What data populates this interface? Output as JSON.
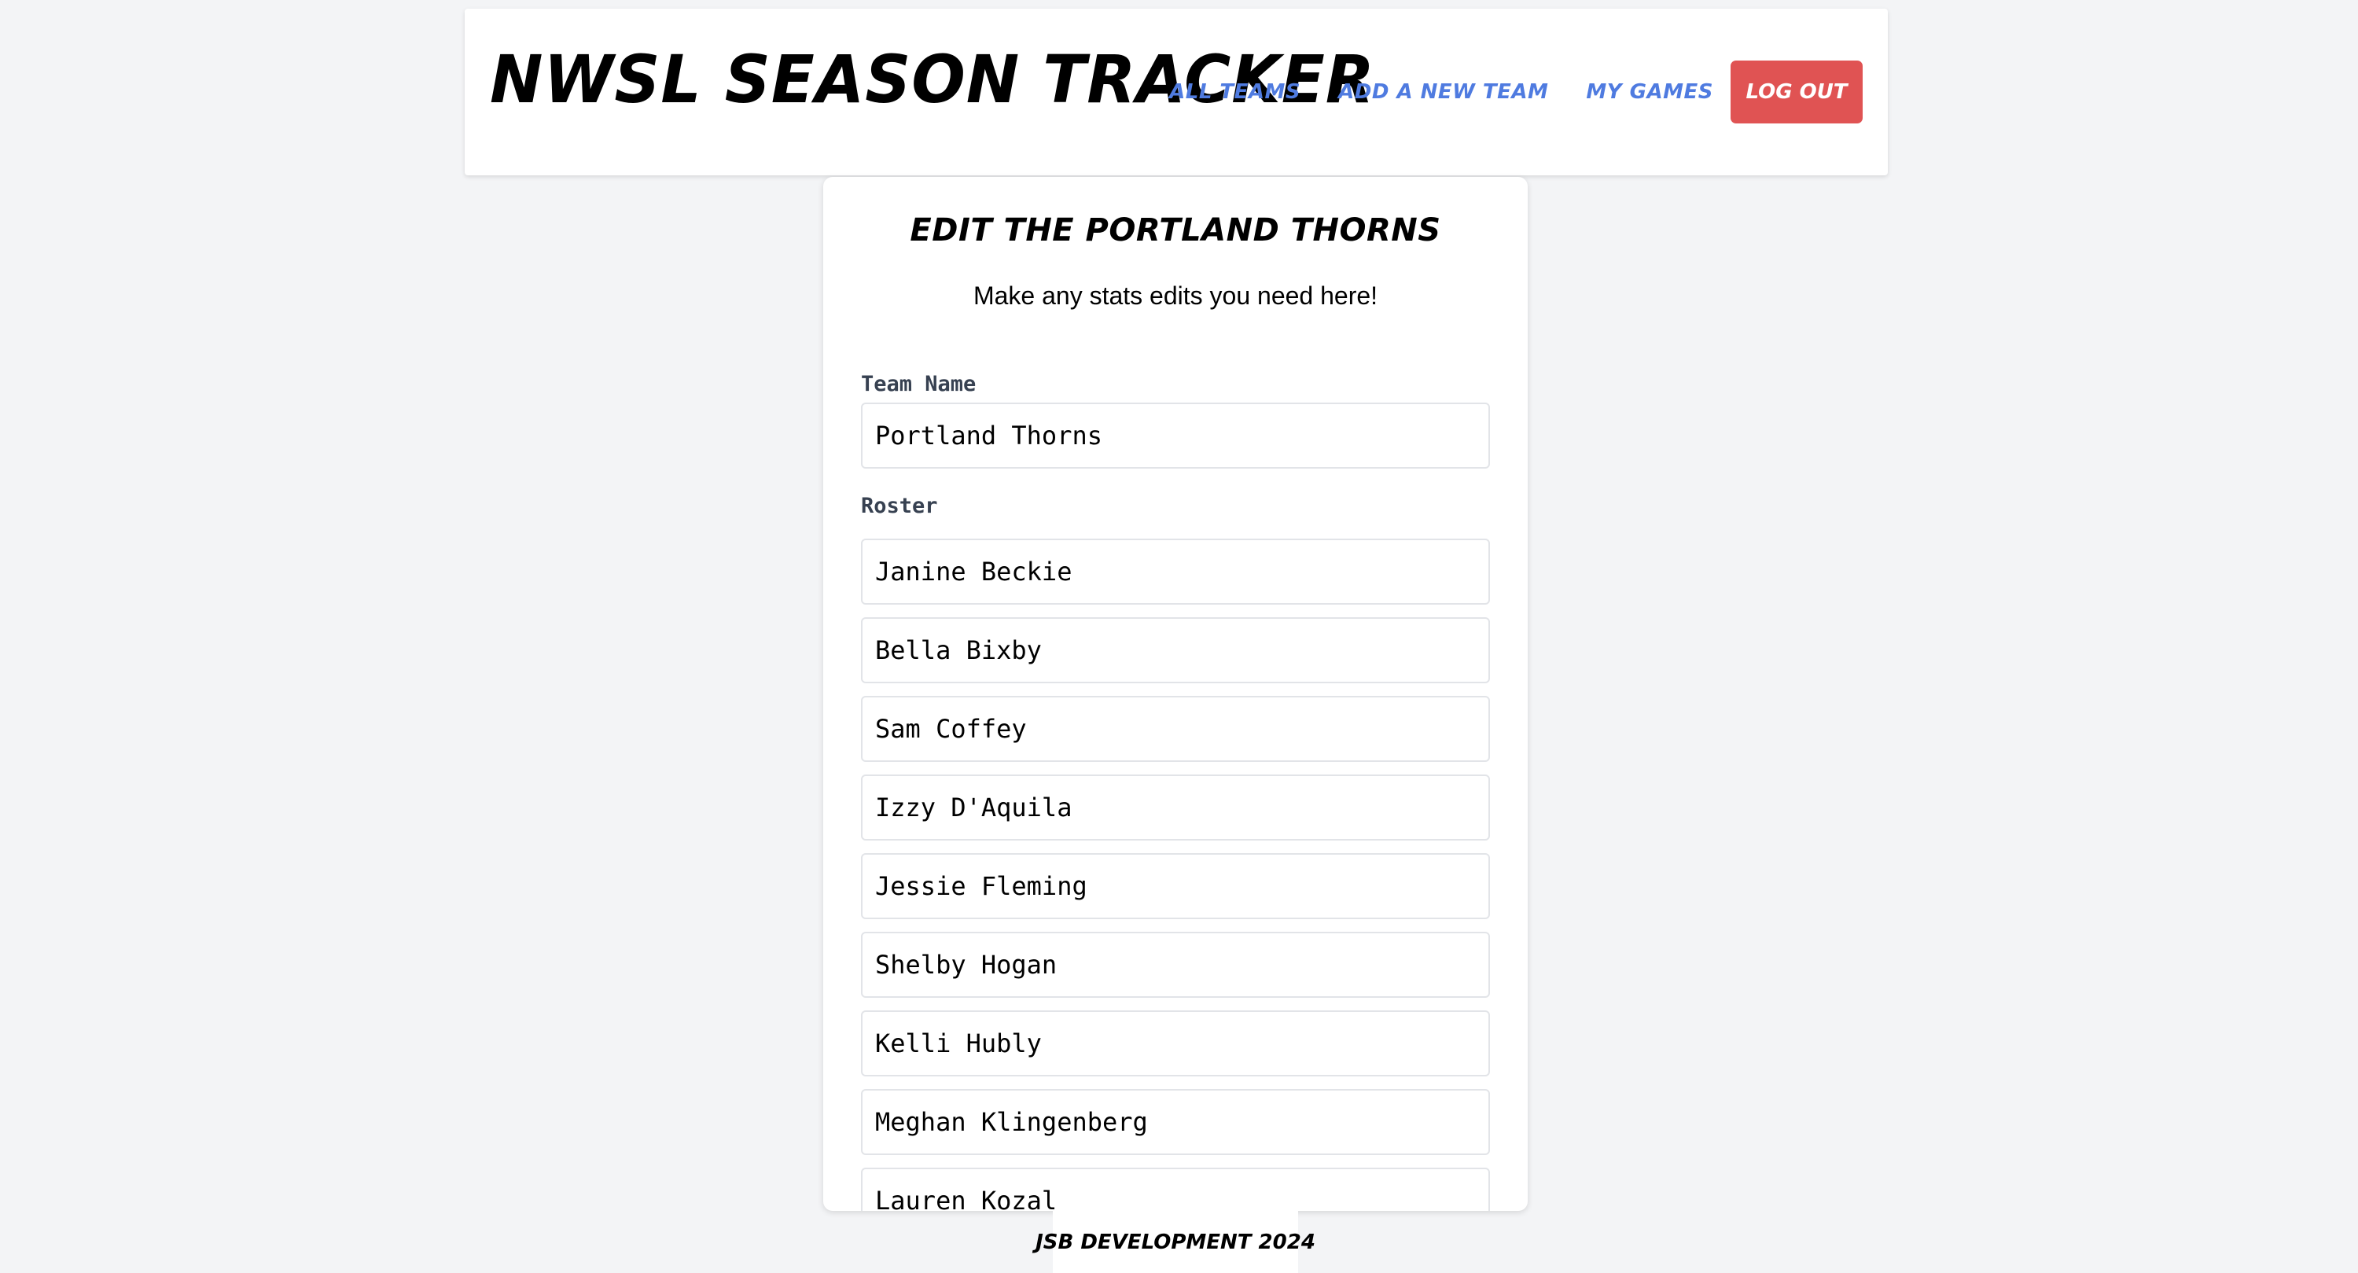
{
  "header": {
    "title": "NWSL SEASON TRACKER",
    "nav": {
      "all_teams": "ALL TEAMS",
      "add_team": "ADD A NEW TEAM",
      "my_games": "MY GAMES",
      "logout": "LOG OUT"
    }
  },
  "card": {
    "title": "EDIT THE PORTLAND THORNS",
    "subtitle": "Make any stats edits you need here!",
    "team_name_label": "Team Name",
    "team_name_value": "Portland Thorns",
    "roster_label": "Roster",
    "roster": [
      "Janine Beckie",
      "Bella Bixby",
      "Sam Coffey",
      "Izzy D'Aquila",
      "Jessie Fleming",
      "Shelby Hogan",
      "Kelli Hubly",
      "Meghan Klingenberg",
      "Lauren Kozal"
    ]
  },
  "footer": {
    "text": "JSB DEVELOPMENT 2024"
  },
  "colors": {
    "background": "#f3f4f6",
    "nav_link": "#4f7be0",
    "logout_button": "#e05353",
    "label_text": "#374151"
  }
}
